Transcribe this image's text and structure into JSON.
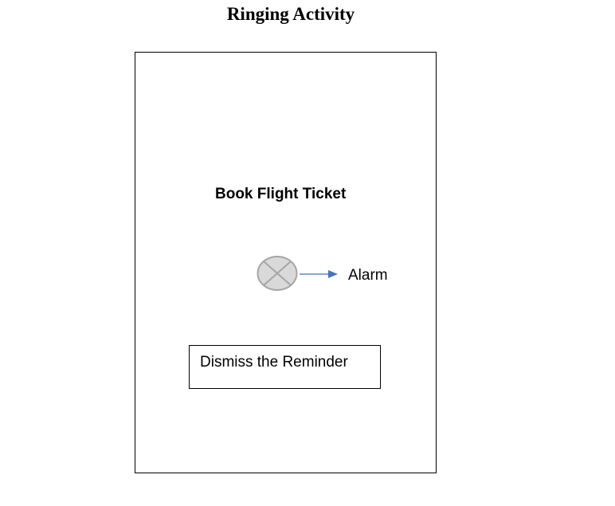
{
  "title": "Ringing Activity",
  "screen": {
    "reminder_title": "Book Flight Ticket",
    "alarm_label": "Alarm",
    "dismiss_button_label": "Dismiss the Reminder"
  },
  "icons": {
    "alarm_symbol": "alarm-placeholder-icon",
    "pointer": "arrow-right-icon"
  },
  "colors": {
    "arrow": "#4472C4",
    "symbol_fill": "#D9D9D9",
    "symbol_stroke": "#A6A6A6"
  }
}
